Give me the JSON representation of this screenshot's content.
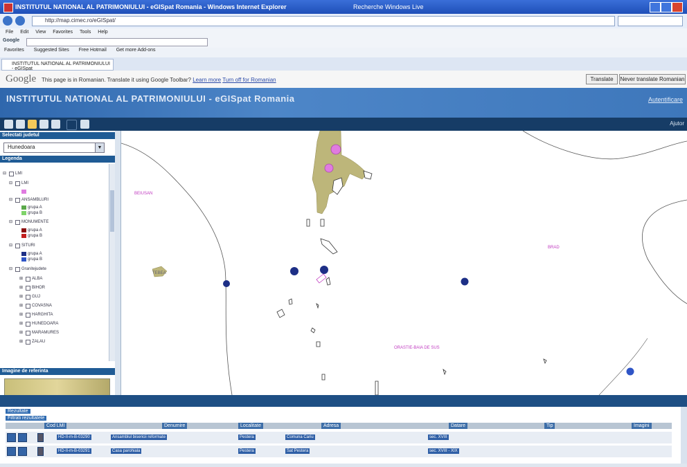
{
  "window": {
    "title": "INSTITUTUL NATIONAL AL PATRIMONIULUI - eGISpat Romania - Windows Internet Explorer",
    "right_text": "Recherche Windows Live"
  },
  "browser": {
    "address": "http://map.cimec.ro/eGISpat/",
    "menu": [
      "File",
      "Edit",
      "View",
      "Favorites",
      "Tools",
      "Help"
    ],
    "google_label": "Google",
    "favorites": [
      "Favorites",
      "Suggested Sites",
      "Free Hotmail",
      "Get more Add-ons"
    ],
    "tab_title": "INSTITUTUL NATIONAL AL PATRIMONIULUI - eGISpat"
  },
  "translate": {
    "logo": "Google",
    "message": "This page is in Romanian.  Translate it using Google Toolbar?",
    "link1": "Learn more",
    "link2": "Turn off for Romanian",
    "translate_button": "Translate",
    "never_button": "Never translate Romanian"
  },
  "app": {
    "title": "INSTITUTUL NATIONAL AL PATRIMONIULUI - eGISpat Romania",
    "header_link": "Autentificare",
    "toolbar_right": "Ajutor"
  },
  "left_panel": {
    "select_header": "Selectati judetul",
    "county_value": "Hunedoara",
    "legend_header": "Legenda",
    "legend": {
      "root": "LMI",
      "groups": [
        {
          "label": "LMI",
          "items": []
        },
        {
          "label": "ANSAMBLURI",
          "items": [
            "grupa A",
            "grupa B"
          ]
        },
        {
          "label": "MONUMENTE",
          "items": [
            "grupa A",
            "grupa B"
          ]
        },
        {
          "label": "SITURI",
          "items": [
            "grupa A",
            "grupa B"
          ]
        }
      ],
      "boundaries_label": "Granitejudete",
      "counties": [
        "ALBA",
        "BIHOR",
        "GUJ",
        "COVASNA",
        "HARGHITA",
        "HUNEDOARA",
        "MARAMURES",
        "ZALAU"
      ]
    },
    "overview_header": "Imagine de referinta"
  },
  "map": {
    "labels": {
      "left": "BEIUSAN",
      "right": "BRAD",
      "bottom": "ORASTIE-BAIA DE SUS",
      "mid_left": "TEBEA"
    }
  },
  "results": {
    "count": "Rezultate",
    "filter": "Filtrati rezultatele",
    "columns": [
      "Cod LMI",
      "Denumire",
      "Localitate",
      "Adresa",
      "Datare",
      "Tip",
      "Imagini"
    ],
    "rows": [
      {
        "code": "HD-II-m-B-03290",
        "name": "Ansamblul bisericii reformate",
        "locality": "Pestera",
        "address": "Comuna Cariu",
        "date": "sec. XVIII"
      },
      {
        "code": "HD-II-m-B-03291",
        "name": "Casa parohiala",
        "locality": "Pestera",
        "address": "Sat Pestera",
        "date": "sec. XVIII - XIX"
      }
    ]
  },
  "colors": {
    "header_blue": "#3e77bb",
    "panel_header": "#1f5b95",
    "lmi": "#e07be0",
    "ansambluri_a": "#5aa84a",
    "ansambluri_b": "#7fd36a",
    "monumente_a": "#8b0d0d",
    "monumente_b": "#c21e1e",
    "situri_a": "#1d2f86",
    "situri_b": "#2f55c6",
    "urban_area": "#bdb67a"
  }
}
